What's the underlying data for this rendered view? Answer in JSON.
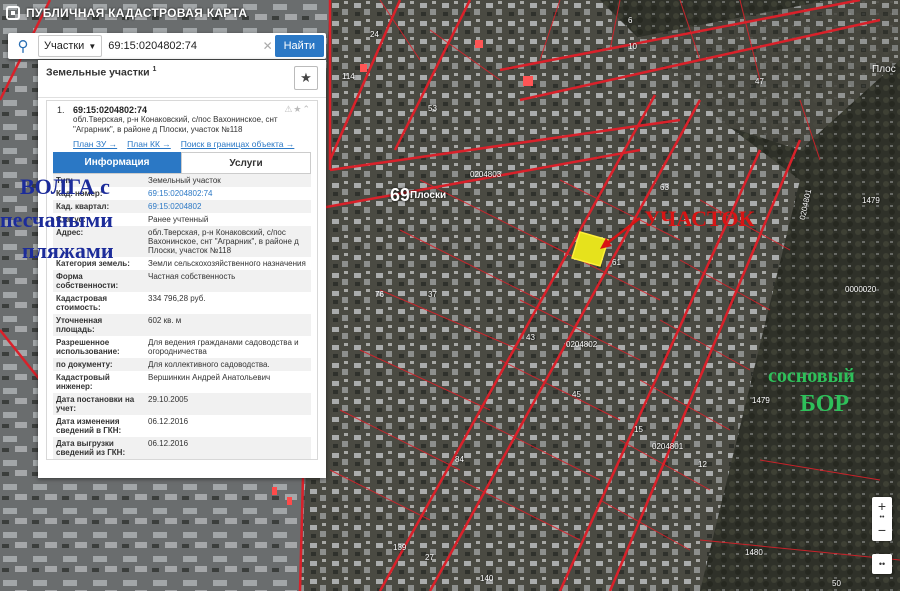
{
  "header": {
    "title": "ПУБЛИЧНАЯ КАДАСТРОВАЯ КАРТА"
  },
  "search": {
    "type_label": "Участки",
    "query": "69:15:0204802:74",
    "find_button": "Найти"
  },
  "results": {
    "heading": "Земельные участки",
    "count": "1",
    "item": {
      "number": "1.",
      "cad_number": "69:15:0204802:74",
      "address": "обл.Тверская, р-н Конаковский, с/пос Вахонинское, снт \"Аграрник\", в районе д Плоски, участок №118",
      "links": [
        "План ЗУ →",
        "План КК →",
        "Поиск в границах объекта →"
      ]
    },
    "tabs": [
      "Информация",
      "Услуги"
    ],
    "rows": [
      {
        "k": "Тип:",
        "v": "Земельный участок"
      },
      {
        "k": "Кад. номер:",
        "v": "69:15:0204802:74"
      },
      {
        "k": "Кад. квартал:",
        "v": "69:15:0204802"
      },
      {
        "k": "Статус:",
        "v": "Ранее учтенный"
      },
      {
        "k": "Адрес:",
        "v": "обл.Тверская, р-н Конаковский, с/пос Вахонинское, снт \"Аграрник\", в районе д Плоски, участок №118"
      },
      {
        "k": "Категория земель:",
        "v": "Земли сельскохозяйственного назначения"
      },
      {
        "k": "Форма собственности:",
        "v": "Частная собственность"
      },
      {
        "k": "Кадастровая стоимость:",
        "v": "334 796,28 руб."
      },
      {
        "k": "Уточненная площадь:",
        "v": "602 кв. м"
      },
      {
        "k": "Разрешенное использование:",
        "v": "Для ведения гражданами садоводства и огородничества"
      },
      {
        "k": "по документу:",
        "v": "Для коллективного садоводства."
      },
      {
        "k": "Кадастровый инженер:",
        "v": "Вершинкин Андрей Анатольевич"
      },
      {
        "k": "Дата постановки на учет:",
        "v": "29.10.2005"
      },
      {
        "k": "Дата изменения сведений в ГКН:",
        "v": "06.12.2016"
      },
      {
        "k": "Дата выгрузки сведений из ГКН:",
        "v": "06.12.2016"
      }
    ]
  },
  "overlays": {
    "volga_line1": "ВОЛГА с",
    "volga_line2": "песчаными",
    "volga_line3": "пляжами",
    "uchastok": "УЧАСТОК",
    "bor_line1": "сосновый",
    "bor_line2": "БОР"
  },
  "map": {
    "place_num": "69",
    "place_name": "Плоски",
    "place_right": "Плос",
    "quarters": [
      "0204803",
      "0204802",
      "0204801",
      "0204801"
    ],
    "code_right": "0000020",
    "numbers": [
      "24",
      "114",
      "53",
      "10",
      "47",
      "6",
      "63",
      "61",
      "76",
      "43",
      "37",
      "45",
      "15",
      "84",
      "12",
      "139",
      "27",
      "140",
      "1479",
      "1479",
      "1480",
      "50"
    ]
  },
  "zoom": {
    "plus": "+",
    "minus": "−"
  },
  "colors": {
    "accent": "#2b78c5",
    "overlay_blue": "#1c2c9a",
    "overlay_red": "#d81414",
    "overlay_green": "#2ec05a",
    "boundary": "#d9212a"
  }
}
